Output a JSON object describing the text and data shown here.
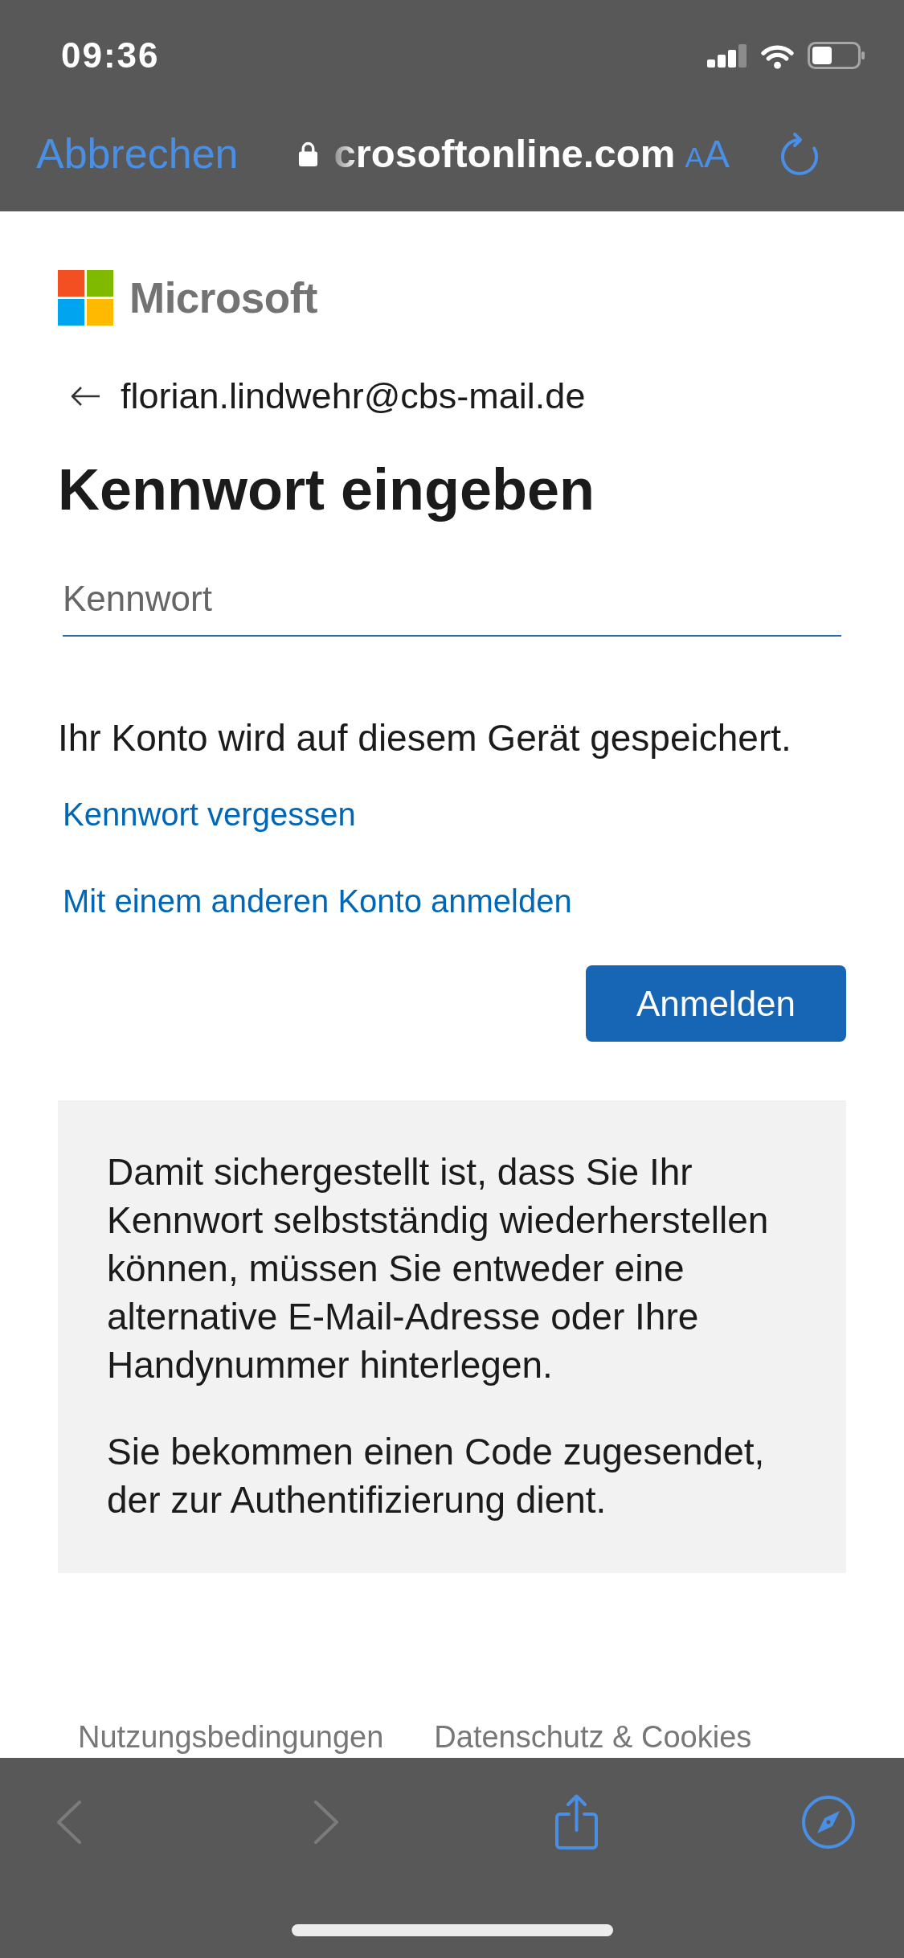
{
  "status_bar": {
    "time": "09:36"
  },
  "browser_bar": {
    "cancel_label": "Abbrechen",
    "secure": true,
    "url": "crosoftonline.com",
    "text_size_label": "AA"
  },
  "sign_in": {
    "logo_text": "Microsoft",
    "email": "florian.lindwehr@cbs-mail.de",
    "title": "Kennwort eingeben",
    "password_field": {
      "placeholder": "Kennwort"
    },
    "notice": "Ihr Konto wird auf diesem Gerät gespeichert.",
    "links": [
      "Kennwort vergessen",
      "Mit einem anderen Konto anmelden"
    ],
    "submit_button": "Anmelden",
    "info_box": {
      "paragraphs": [
        "Damit sichergestellt ist, dass Sie Ihr Kennwort selbstständig wiederherstellen können, müssen Sie entweder eine alternative E-Mail-Adresse oder Ihre Handynummer hinterlegen.",
        "Sie bekommen einen Code zugesendet, der zur Authentifizierung dient."
      ]
    },
    "footer_links": [
      "Nutzungsbedingungen",
      "Datenschutz & Cookies"
    ]
  },
  "toolbar": {
    "buttons": [
      {
        "kind": "back",
        "disabled": true
      },
      {
        "kind": "forward",
        "disabled": true
      },
      {
        "kind": "share",
        "disabled": false
      },
      {
        "kind": "compass",
        "disabled": false
      }
    ]
  }
}
